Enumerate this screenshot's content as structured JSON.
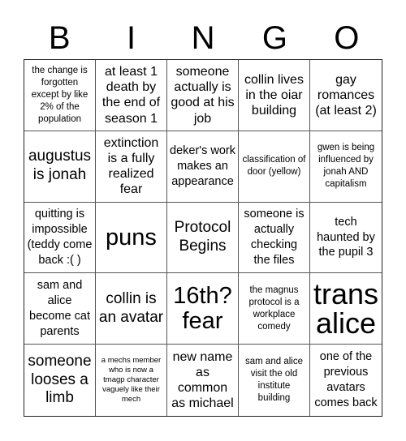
{
  "header": {
    "letters": [
      "B",
      "I",
      "N",
      "G",
      "O"
    ]
  },
  "board": {
    "cells": [
      "the change is forgotten except by like 2% of the population",
      "at least 1 death by the end of season 1",
      "someone actually is good at his job",
      "collin lives in the oiar building",
      "gay romances (at least 2)",
      "augustus is jonah",
      "extinction is a fully realized fear",
      "deker's work makes an appearance",
      "classification of door (yellow)",
      "gwen is being influenced by jonah AND capitalism",
      "quitting is impossible (teddy come back :( )",
      "puns",
      "Protocol Begins",
      "someone is actually checking the files",
      "tech haunted by the pupil 3",
      "sam and alice become cat parents",
      "collin is an avatar",
      "16th? fear",
      "the magnus protocol is a workplace comedy",
      "trans alice",
      "someone looses a limb",
      "a mechs member who is now a tmagp character vaguely like their mech",
      "new name as common as michael",
      "sam and alice visit the old institute building",
      "one of the previous avatars comes back"
    ]
  }
}
